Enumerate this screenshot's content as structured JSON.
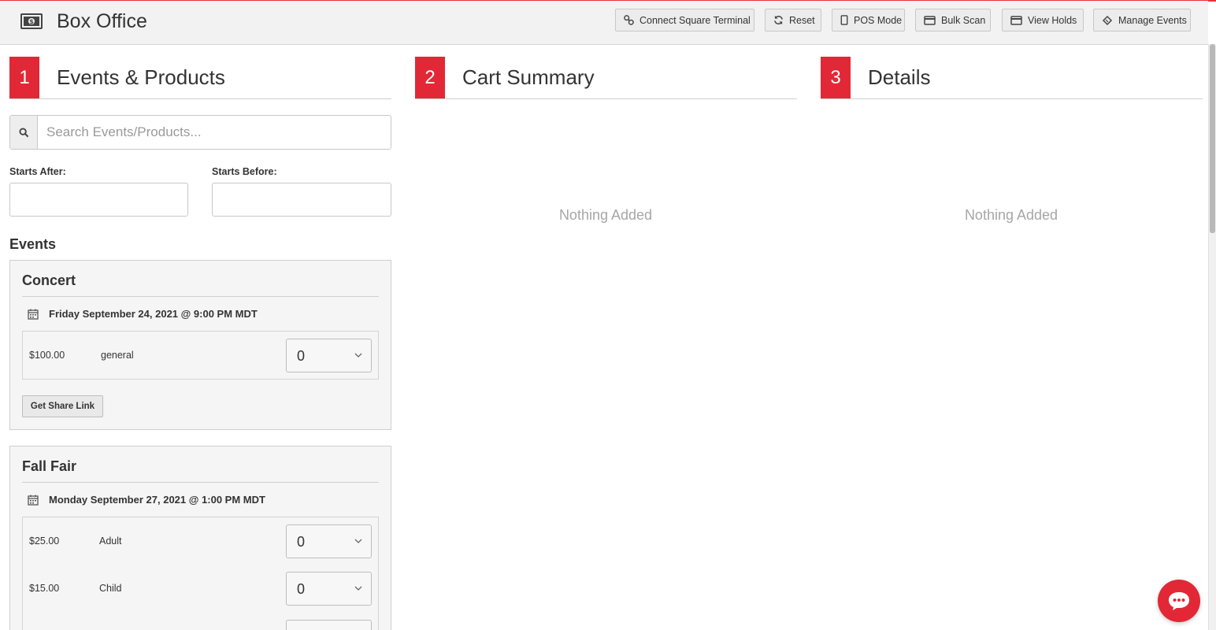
{
  "header": {
    "title": "Box Office",
    "buttons": [
      {
        "label": "Connect Square Terminal",
        "icon": "link-icon"
      },
      {
        "label": "Reset",
        "icon": "refresh-icon"
      },
      {
        "label": "POS Mode",
        "icon": "tablet-icon"
      },
      {
        "label": "Bulk Scan",
        "icon": "card-icon"
      },
      {
        "label": "View Holds",
        "icon": "card-icon"
      },
      {
        "label": "Manage Events",
        "icon": "ticket-icon"
      }
    ]
  },
  "colors": {
    "accent": "#e22836",
    "header_bg": "#f2f2f2",
    "card_bg": "#f5f5f5"
  },
  "steps": [
    {
      "number": "1",
      "label": "Events & Products"
    },
    {
      "number": "2",
      "label": "Cart Summary"
    },
    {
      "number": "3",
      "label": "Details"
    }
  ],
  "search": {
    "placeholder": "Search Events/Products..."
  },
  "filters": {
    "starts_after_label": "Starts After:",
    "starts_before_label": "Starts Before:"
  },
  "events_heading": "Events",
  "events": [
    {
      "name": "Concert",
      "date": "Friday September 24, 2021 @ 9:00 PM MDT",
      "tickets": [
        {
          "price": "$100.00",
          "name": "general",
          "qty": "0"
        }
      ],
      "share_label": "Get Share Link"
    },
    {
      "name": "Fall Fair",
      "date": "Monday September 27, 2021 @ 1:00 PM MDT",
      "tickets": [
        {
          "price": "$25.00",
          "name": "Adult",
          "qty": "0"
        },
        {
          "price": "$15.00",
          "name": "Child",
          "qty": "0"
        }
      ]
    }
  ],
  "cart": {
    "empty_text": "Nothing Added"
  },
  "details": {
    "empty_text": "Nothing Added"
  }
}
